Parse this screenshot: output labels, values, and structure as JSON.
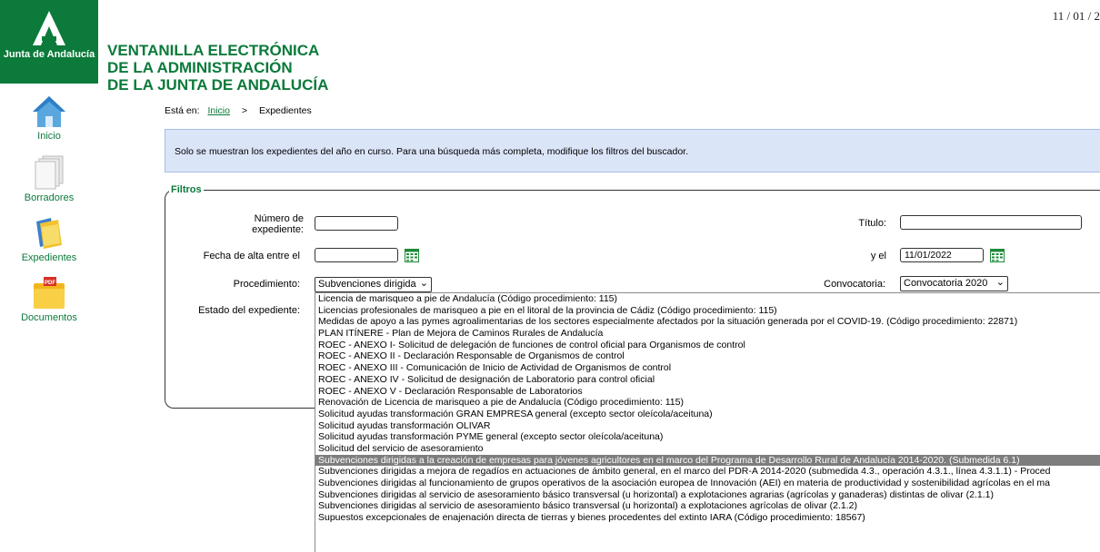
{
  "header": {
    "date": "11 / 01 / 2",
    "logo_text": "Junta de Andalucía",
    "title_lines": [
      "VENTANILLA ELECTRÓNICA",
      "DE LA ADMINISTRACIÓN",
      "DE LA JUNTA DE ANDALUCÍA"
    ]
  },
  "sidebar": {
    "items": [
      {
        "label": "Inicio",
        "icon": "home-icon"
      },
      {
        "label": "Borradores",
        "icon": "drafts-icon"
      },
      {
        "label": "Expedientes",
        "icon": "folder-icon"
      },
      {
        "label": "Documentos",
        "icon": "pdf-folder-icon"
      }
    ]
  },
  "breadcrumb": {
    "prefix": "Está en:",
    "home": "Inicio",
    "separator": ">",
    "current": "Expedientes"
  },
  "info_message": "Solo se muestran los expedientes del año en curso. Para una búsqueda más completa, modifique los filtros del buscador.",
  "filters": {
    "legend": "Filtros",
    "numero_label": "Número de expediente:",
    "numero_value": "",
    "titulo_label": "Título:",
    "titulo_value": "",
    "fecha_label": "Fecha de alta entre el",
    "fecha_from_value": "",
    "y_el_label": "y el",
    "fecha_to_value": "11/01/2022",
    "procedimiento_label": "Procedimiento:",
    "procedimiento_selected": "Subvenciones dirigida",
    "convocatoria_label": "Convocatoria:",
    "convocatoria_selected": "Convocatoria 2020",
    "estado_label": "Estado del expediente:"
  },
  "dropdown_options": [
    "Licencia de marisqueo a pie de Andalucía (Código procedimiento: 115)",
    "Licencias profesionales de marisqueo a pie en el litoral de la provincia de Cádiz (Código procedimiento: 115)",
    "Medidas de apoyo a las pymes agroalimentarias de los sectores especialmente afectados por la situación generada por el COVID-19. (Código procedimiento: 22871)",
    "PLAN ITÍNERE - Plan de Mejora de Caminos Rurales de Andalucía",
    "ROEC - ANEXO I- Solicitud de delegación de funciones de control oficial para Organismos de control",
    "ROEC - ANEXO II - Declaración Responsable de Organismos de control",
    "ROEC - ANEXO III - Comunicación de Inicio de Actividad de Organismos de control",
    "ROEC - ANEXO IV - Solicitud de designación de Laboratorio para control oficial",
    "ROEC - ANEXO V - Declaración Responsable de Laboratorios",
    "Renovación de Licencia de marisqueo a pie de Andalucía (Código procedimiento: 115)",
    "Solicitud ayudas transformación GRAN EMPRESA general (excepto sector oleícola/aceituna)",
    "Solicitud ayudas transformación OLIVAR",
    "Solicitud ayudas transformación PYME general (excepto sector oleícola/aceituna)",
    "Solicitud del servicio de asesoramiento",
    "Subvenciones dirigidas a la creación de empresas para jóvenes agricultores en el marco del Programa de Desarrollo Rural de Andalucía 2014-2020. (Submedida 6.1)",
    "Subvenciones dirigidas a mejora de regadíos en actuaciones de ámbito general, en el marco del PDR-A 2014-2020 (submedida 4.3., operación 4.3.1., línea 4.3.1.1) - Proced",
    "Subvenciones dirigidas al funcionamiento de grupos operativos de la asociación europea de Innovación (AEI) en materia de productividad y sostenibilidad agrícolas en el ma",
    "Subvenciones dirigidas al servicio de asesoramiento básico transversal (u horizontal) a explotaciones agrarias (agrícolas y ganaderas) distintas de olivar (2.1.1)",
    "Subvenciones dirigidas al servicio de asesoramiento básico transversal (u horizontal) a explotaciones agrícolas de olivar (2.1.2)",
    "Supuestos excepcionales de enajenación directa de tierras y bienes procedentes del extinto IARA (Código procedimiento: 18567)"
  ],
  "selected_option_index": 14,
  "colors": {
    "brand_green": "#0b7a3a",
    "info_bg": "#dbe5f8",
    "selected_option_bg": "#7d7d7d"
  }
}
